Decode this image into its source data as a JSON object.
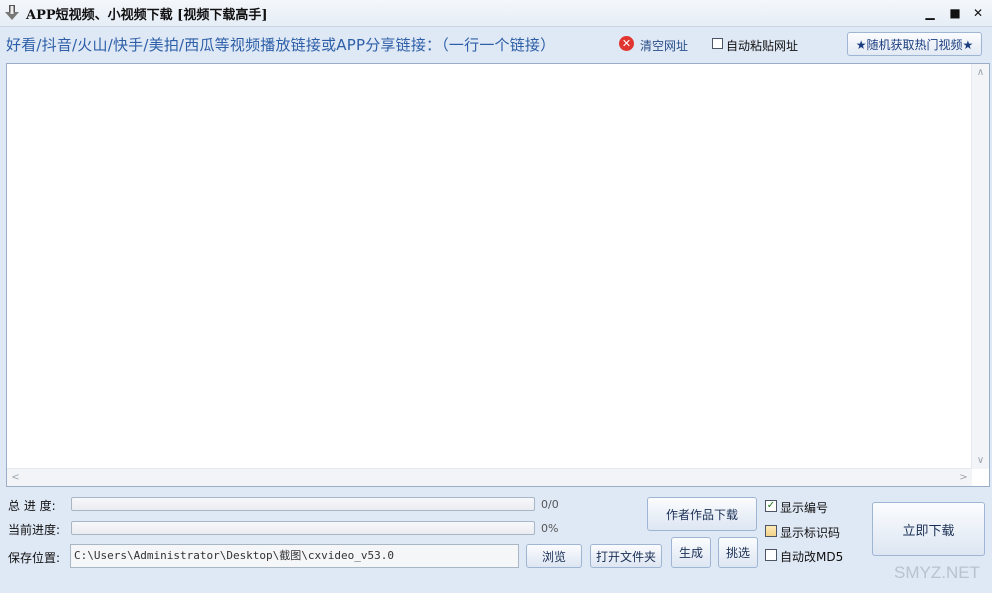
{
  "window": {
    "title": "APP短视频、小视频下载 [视频下载高手]",
    "minimize_glyph": "▁",
    "maximize_glyph": "■",
    "close_glyph": "✕"
  },
  "url_input": {
    "label": "好看/抖音/火山/快手/美拍/西瓜等视频播放链接或APP分享链接：（一行一个链接）",
    "value": "",
    "clear_icon_glyph": "✕",
    "clear_label": "清空网址",
    "auto_paste_label": "自动粘贴网址",
    "auto_paste_checked": false,
    "random_hot_button": "★随机获取热门视频★"
  },
  "progress": {
    "total_label": "总 进 度:",
    "total_value": "0/0",
    "total_fraction": 0,
    "current_label": "当前进度:",
    "current_value": "0%",
    "current_fraction": 0
  },
  "save": {
    "label": "保存位置:",
    "path": "C:\\Users\\Administrator\\Desktop\\截图\\cxvideo_v53.0",
    "browse_button": "浏览",
    "open_folder_button": "打开文件夹"
  },
  "actions": {
    "author_download_button": "作者作品下载",
    "generate_button": "生成",
    "pick_button": "挑选",
    "download_now_button": "立即下载"
  },
  "options": [
    {
      "label": "显示编号",
      "checked": true
    },
    {
      "label": "显示标识码",
      "checked": false
    },
    {
      "label": "自动改MD5",
      "checked": false
    }
  ],
  "scroll": {
    "up": "∧",
    "down": "∨",
    "left": "<",
    "right": ">"
  },
  "watermark": "SMYZ.NET",
  "colors": {
    "accent": "#2d5fa8",
    "clear_icon": "#e0362f",
    "background": "#dfe8f5"
  }
}
